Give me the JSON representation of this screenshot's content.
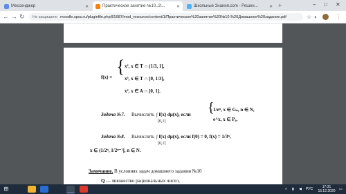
{
  "tabs": [
    {
      "label": "Мессенджер",
      "icon": "messenger-icon",
      "color": "#5b8def",
      "active": false
    },
    {
      "label": "Практическое занятие №10..2\\...",
      "icon": "moodle-icon",
      "color": "#f98012",
      "active": true
    },
    {
      "label": "Школьные Знания.com - Решен...",
      "icon": "znanija-icon",
      "color": "#4fb3f6",
      "active": false
    }
  ],
  "toolbar": {
    "insecure_label": "Не защищено",
    "url": "moodle.spsu.ru/pluginfile.php/81687/mod_resource/content/1/Практическое%20занятие%20№10.%20Домашнее%20задание.pdf"
  },
  "pdf": {
    "func_lhs": "f(x) =",
    "line1": "x², x ∈ T ∩ (1/3, 1],",
    "line2": "x³, x ∈ T ∩ [0, 1/3],",
    "line3": "x², x ∈ A ∩ [0, 1].",
    "task7_label": "Задача №7.",
    "task7_text": "Вычислить",
    "task7_int": "∫ f(x) dμ(x), если",
    "task7_bounds": "[0,1]",
    "task7_case1": "1/eⁿ, x ∈ Gₙ, n ∈ N,",
    "task7_case2": "e^x, x ∈ P₀.",
    "task8_label": "Задача №8.",
    "task8_text": "Вычислить",
    "task8_int": "∫ f(x) dμ(x), если f(0) = 0, f(x) = 1/3ⁿ,",
    "task8_bounds": "[0,1]",
    "task8_line2": "x ∈ (1/2ⁿ, 1/2ⁿ⁻¹], n ∈ N.",
    "note_label": "Замечание.",
    "note_text": "В условиях задач домашнего задания №10",
    "note_line2": "— множество рациональных чисел,"
  },
  "taskbar": {
    "time": "17:31",
    "date": "15.12.2020",
    "lang": "РУС"
  }
}
